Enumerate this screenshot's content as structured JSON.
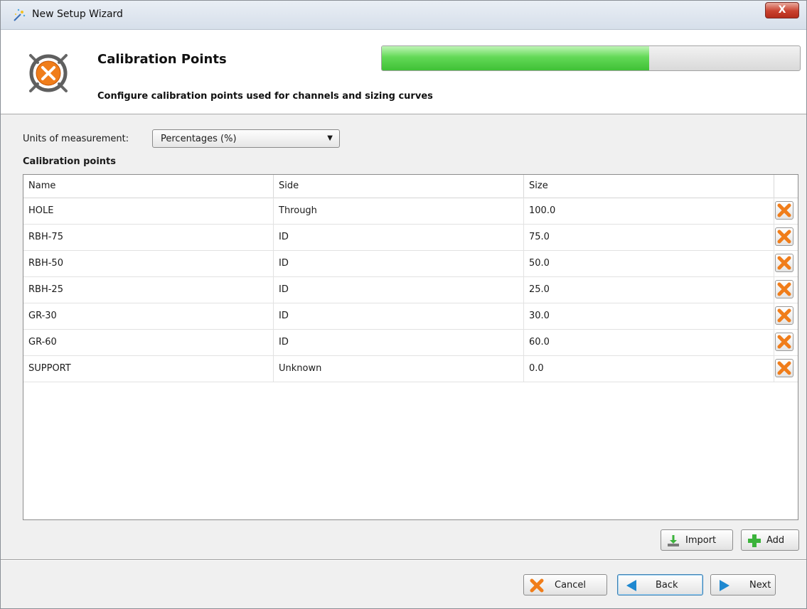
{
  "window": {
    "title": "New Setup Wizard",
    "close_label": "X"
  },
  "header": {
    "title": "Calibration Points",
    "subtitle": "Configure calibration points used for channels and sizing curves",
    "progress_percent": 64,
    "progress_color": "#4fcf45"
  },
  "units": {
    "label": "Units of measurement:",
    "selected": "Percentages (%)"
  },
  "section_label": "Calibration points",
  "table": {
    "columns": [
      "Name",
      "Side",
      "Size"
    ],
    "rows": [
      {
        "name": "HOLE",
        "side": "Through",
        "size": "100.0"
      },
      {
        "name": "RBH-75",
        "side": "ID",
        "size": "75.0"
      },
      {
        "name": "RBH-50",
        "side": "ID",
        "size": "50.0"
      },
      {
        "name": "RBH-25",
        "side": "ID",
        "size": "25.0"
      },
      {
        "name": "GR-30",
        "side": "ID",
        "size": "30.0"
      },
      {
        "name": "GR-60",
        "side": "ID",
        "size": "60.0"
      },
      {
        "name": "SUPPORT",
        "side": "Unknown",
        "size": "0.0"
      }
    ]
  },
  "actions": {
    "import_label": "Import",
    "add_label": "Add"
  },
  "footer": {
    "cancel_label": "Cancel",
    "back_label": "Back",
    "next_label": "Next"
  },
  "colors": {
    "accent_orange": "#f07d1a",
    "nav_blue": "#1e88d0",
    "add_green": "#3bb33b"
  },
  "icons": {
    "title": "wizard-wand-icon",
    "header": "calibration-target-icon",
    "delete": "delete-x-icon",
    "import": "import-download-icon",
    "add": "add-plus-icon",
    "cancel": "cancel-x-icon",
    "back": "back-arrow-icon",
    "next": "next-arrow-icon"
  }
}
